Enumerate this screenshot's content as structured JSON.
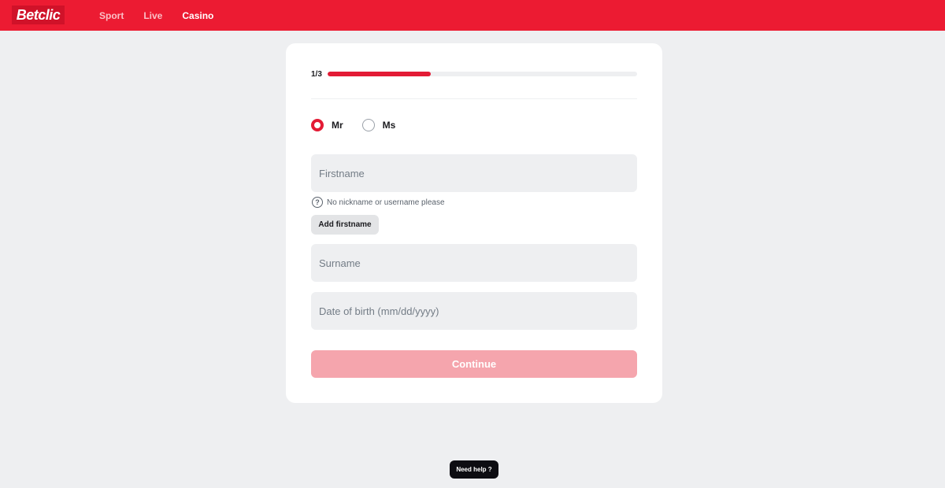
{
  "brand": {
    "logo_text": "Betclic",
    "accent_color": "#ec1b32"
  },
  "nav": {
    "items": [
      {
        "label": "Sport",
        "active": false
      },
      {
        "label": "Live",
        "active": false
      },
      {
        "label": "Casino",
        "active": true
      }
    ]
  },
  "form": {
    "step_label": "1/3",
    "progress_fraction": 0.333,
    "gender": {
      "options": [
        {
          "label": "Mr",
          "selected": true
        },
        {
          "label": "Ms",
          "selected": false
        }
      ]
    },
    "firstname": {
      "placeholder": "Firstname",
      "value": ""
    },
    "firstname_hint": {
      "icon": "question-circle-icon",
      "text": "No nickname or username please"
    },
    "add_firstname_label": "Add firstname",
    "surname": {
      "placeholder": "Surname",
      "value": ""
    },
    "dob": {
      "placeholder": "Date of birth (mm/dd/yyyy)",
      "value": ""
    },
    "continue_label": "Continue",
    "continue_disabled_color": "#f5a5ad"
  },
  "help": {
    "label": "Need help ?"
  }
}
